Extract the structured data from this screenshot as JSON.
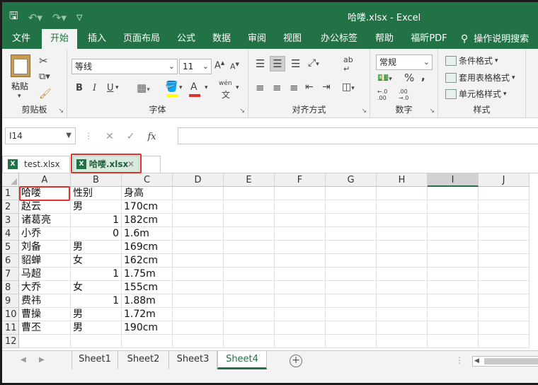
{
  "window": {
    "title": "哈喽.xlsx  -  Excel"
  },
  "qat": {
    "save_icon": "save-icon",
    "undo_icon": "undo-icon",
    "redo_icon": "redo-icon",
    "customize_icon": "customize-icon"
  },
  "ribbon_tabs": [
    "文件",
    "开始",
    "插入",
    "页面布局",
    "公式",
    "数据",
    "审阅",
    "视图",
    "办公标签",
    "帮助",
    "福昕PDF",
    "操作说明搜索"
  ],
  "ribbon": {
    "clipboard": {
      "label": "剪贴板",
      "paste": "粘贴"
    },
    "font": {
      "label": "字体",
      "name": "等线",
      "size": "11",
      "bold": "B",
      "italic": "I",
      "underline": "U",
      "phonetic": "wén"
    },
    "alignment": {
      "label": "对齐方式",
      "wrap": "ab"
    },
    "number": {
      "label": "数字",
      "format": "常规",
      "percent": "%",
      "comma": ",",
      "dec_inc": "←.0 .00",
      "dec_dec": ".00 →.0"
    },
    "styles": {
      "label": "样式",
      "conditional": "条件格式",
      "table": "套用表格格式",
      "cell": "单元格样式"
    }
  },
  "formula_bar": {
    "name_box": "I14",
    "fx": "fx",
    "value": ""
  },
  "doc_tabs": [
    {
      "label": "test.xlsx"
    },
    {
      "label": "哈喽.xlsx"
    }
  ],
  "grid": {
    "columns": [
      "A",
      "B",
      "C",
      "D",
      "E",
      "F",
      "G",
      "H",
      "I",
      "J"
    ],
    "rows": [
      "1",
      "2",
      "3",
      "4",
      "5",
      "6",
      "7",
      "8",
      "9",
      "10",
      "11",
      "12"
    ],
    "cells": [
      [
        "哈喽",
        "性别",
        "身高"
      ],
      [
        "赵云",
        "男",
        "170cm"
      ],
      [
        "诸葛亮",
        "1",
        "182cm"
      ],
      [
        "小乔",
        "0",
        "1.6m"
      ],
      [
        "刘备",
        "男",
        "169cm"
      ],
      [
        "貂蝉",
        "女",
        "162cm"
      ],
      [
        "马超",
        "1",
        "1.75m"
      ],
      [
        "大乔",
        "女",
        "155cm"
      ],
      [
        "费祎",
        "1",
        "1.88m"
      ],
      [
        "曹操",
        "男",
        "1.72m"
      ],
      [
        "曹丕",
        "男",
        "190cm"
      ],
      [
        "",
        "",
        ""
      ]
    ]
  },
  "sheets": [
    "Sheet1",
    "Sheet2",
    "Sheet3",
    "Sheet4"
  ],
  "colors": {
    "accent": "#217346",
    "highlight": "#e0312a"
  }
}
